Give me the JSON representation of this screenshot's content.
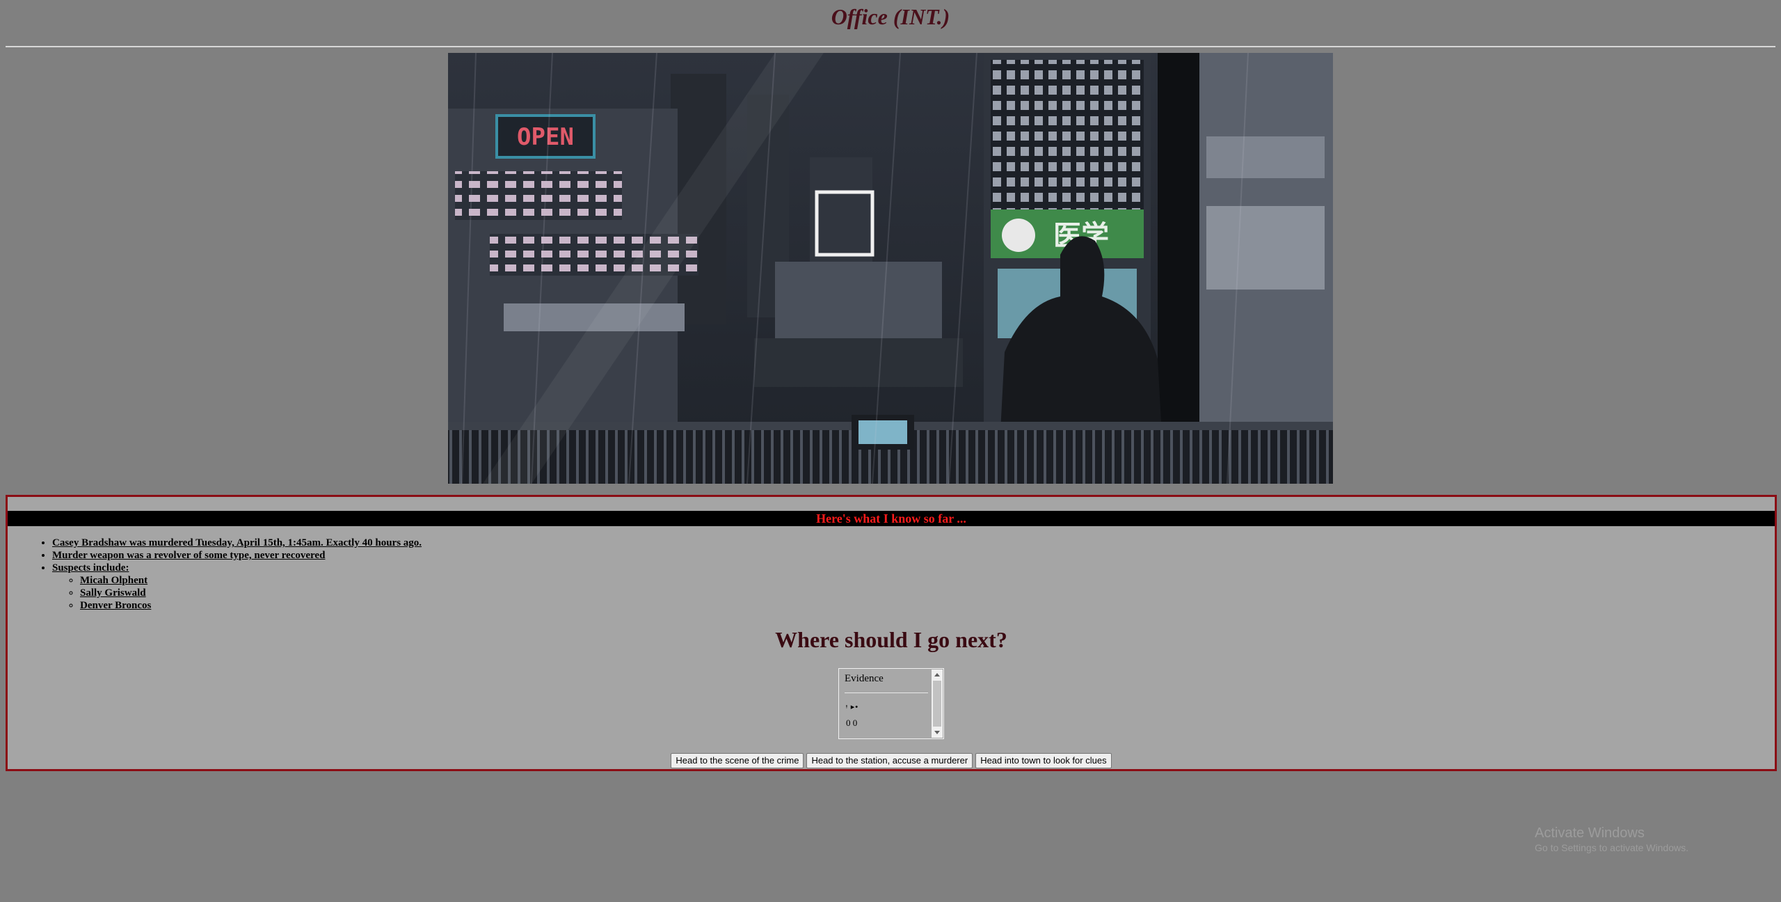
{
  "page": {
    "title": "Office (INT.)"
  },
  "scene_image": {
    "description_icon": "rainy-cityscape-detective-scene"
  },
  "notes": {
    "header": "Here's what I know so far ...",
    "facts": [
      "Casey Bradshaw was murdered Tuesday, April 15th, 1:45am. Exactly 40 hours ago.",
      "Murder weapon was a revolver of some type, never recovered",
      "Suspects include:"
    ],
    "suspects": [
      "Micah Olphent",
      "Sally Griswald",
      "Denver Broncos"
    ]
  },
  "question": "Where should I go next?",
  "evidence": {
    "label": "Evidence",
    "glyph": "ᵎ ▸•",
    "value": "0 0"
  },
  "choices": [
    "Head to the scene of the crime",
    "Head to the station, accuse a murderer",
    "Head into town to look for clues"
  ],
  "os_watermark": {
    "title": "Activate Windows",
    "subtitle": "Go to Settings to activate Windows."
  },
  "colors": {
    "background": "#808080",
    "panel": "#a5a5a5",
    "panel_border": "#8b0d14",
    "header_text": "#ff1a1a",
    "title_text": "#4a0f1a"
  }
}
